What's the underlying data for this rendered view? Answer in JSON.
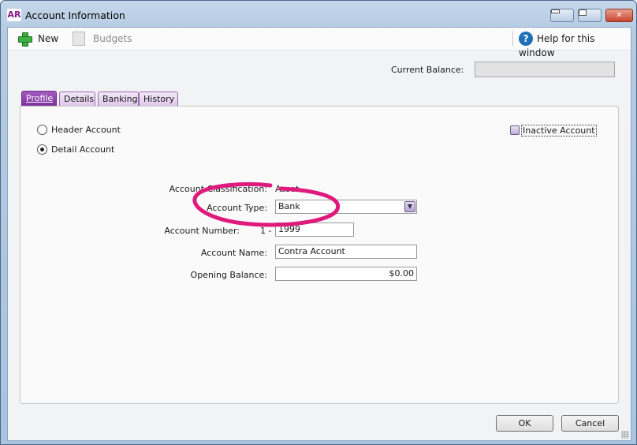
{
  "window": {
    "app_logo": "AR",
    "title": "Account Information",
    "controls": {
      "minimize": "minimize",
      "maximize": "maximize",
      "close": "✕"
    }
  },
  "toolbar": {
    "new_label": "New",
    "budgets_label": "Budgets",
    "help_label": "Help for this window",
    "help_icon_glyph": "?"
  },
  "header": {
    "current_balance_label": "Current Balance:",
    "current_balance_value": ""
  },
  "tabs": [
    {
      "label": "Profile",
      "active": true
    },
    {
      "label": "Details",
      "active": false
    },
    {
      "label": "Banking",
      "active": false
    },
    {
      "label": "History",
      "active": false
    }
  ],
  "profile": {
    "header_account_label": "Header Account",
    "detail_account_label": "Detail Account",
    "selected_account_kind": "Detail Account",
    "inactive_account_label": "Inactive Account",
    "inactive_checked": false,
    "classification_label": "Account Classification:",
    "classification_value": "Asset",
    "type_label": "Account Type:",
    "type_value": "Bank",
    "number_label": "Account Number:",
    "number_prefix": "1 -",
    "number_value": "1999",
    "name_label": "Account Name:",
    "name_value": "Contra Account",
    "opening_balance_label": "Opening Balance:",
    "opening_balance_value": "$0.00"
  },
  "footer": {
    "ok_label": "OK",
    "cancel_label": "Cancel"
  },
  "colors": {
    "accent_purple": "#7a2e98",
    "annotation_pink": "#e0197d",
    "help_blue": "#1e6fb8",
    "new_green": "#3cb043"
  }
}
